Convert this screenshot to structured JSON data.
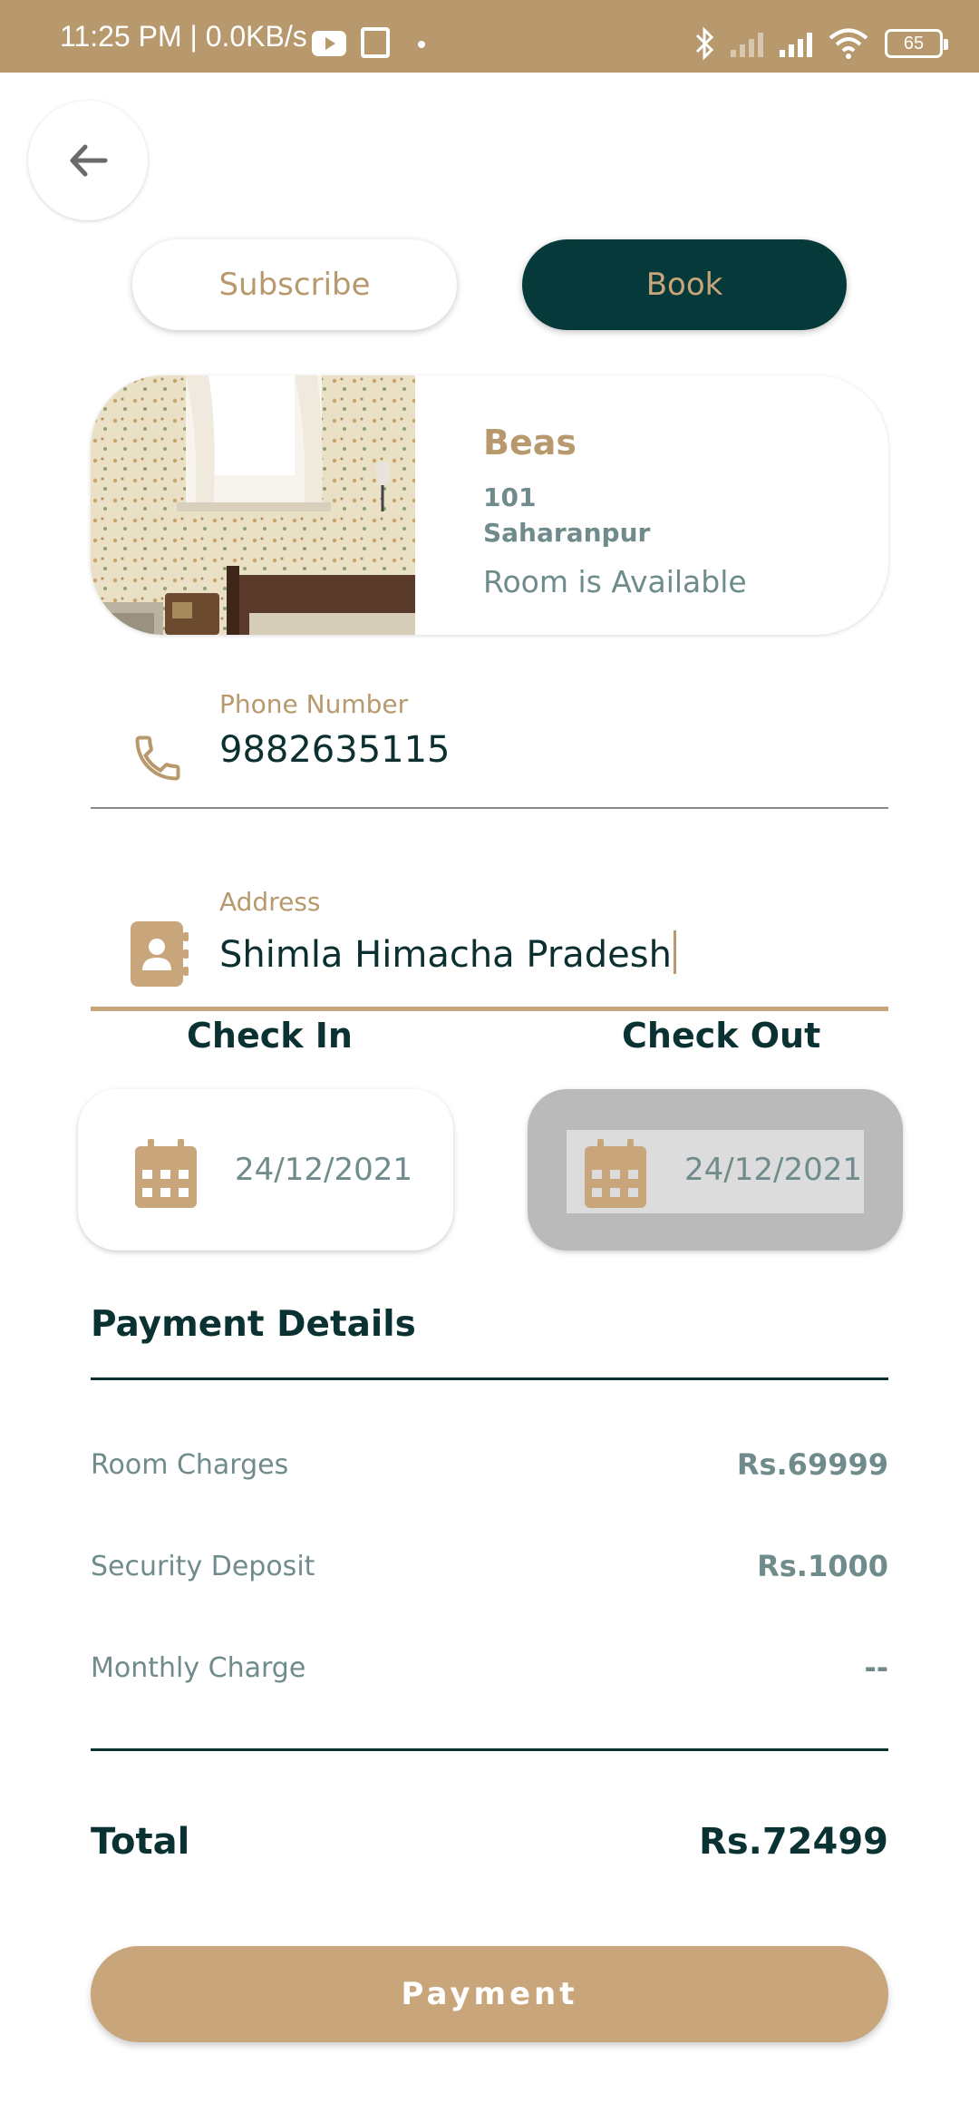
{
  "status_bar": {
    "time": "11:25 PM | 0.0KB/s",
    "battery": "65"
  },
  "header": {
    "subscribe_label": "Subscribe",
    "book_label": "Book"
  },
  "room": {
    "name": "Beas",
    "number": "101",
    "city": "Saharanpur",
    "status": "Room is Available"
  },
  "form": {
    "phone_label": "Phone Number",
    "phone_value": "9882635115",
    "address_label": "Address",
    "address_value": "Shimla Himacha Pradesh"
  },
  "dates": {
    "check_in_label": "Check In",
    "check_out_label": "Check Out",
    "check_in_value": "24/12/2021",
    "check_out_value": "24/12/2021"
  },
  "payment": {
    "title": "Payment Details",
    "rows": [
      {
        "label": "Room Charges",
        "value": "Rs.69999"
      },
      {
        "label": "Security Deposit",
        "value": "Rs.1000"
      },
      {
        "label": "Monthly Charge",
        "value": "--"
      }
    ],
    "total_label": "Total",
    "total_value": "Rs.72499",
    "button_label": "Payment"
  },
  "colors": {
    "accent": "#b8996d",
    "dark": "#06393a",
    "muted_text": "#6f8b8b",
    "button": "#c8a57a"
  }
}
